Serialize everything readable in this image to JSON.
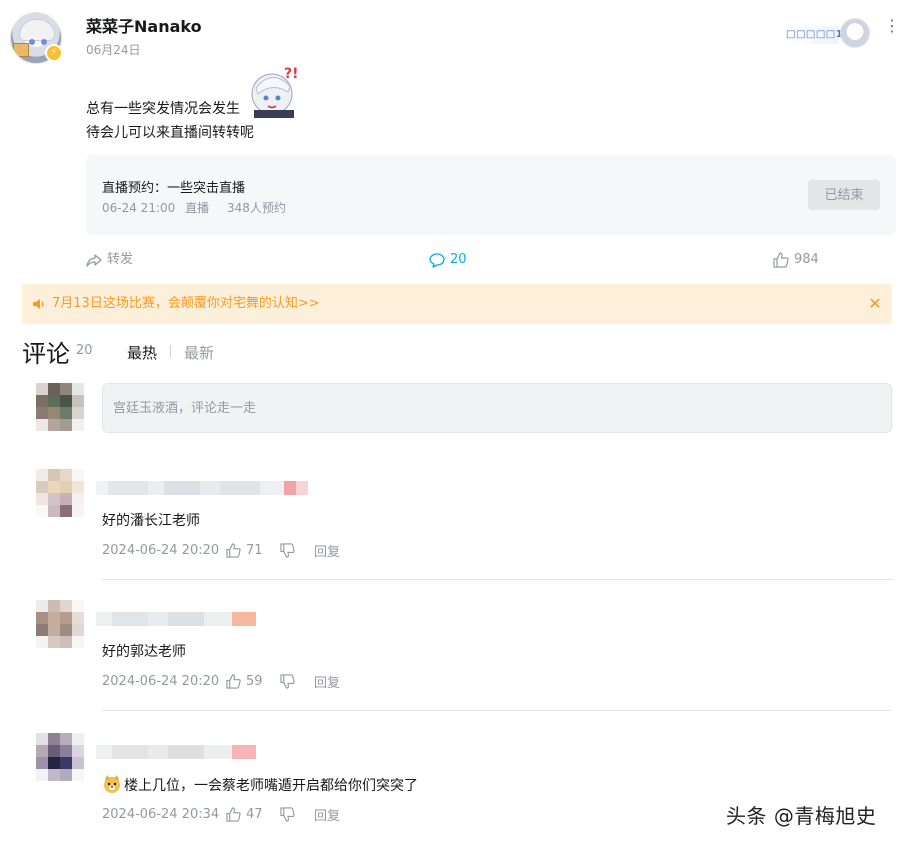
{
  "post": {
    "username": "菜菜子Nanako",
    "date": "06月24日",
    "fan_badge": "□□□□□1",
    "text_line1": "总有一些突发情况会发生",
    "text_line2": "待会儿可以来直播间转转呢",
    "live_card": {
      "title": "直播预约：一些突击直播",
      "time": "06-24 21:00",
      "type": "直播",
      "reservations": "348人预约",
      "status_button": "已结束"
    },
    "actions": {
      "forward": "转发",
      "comments": "20",
      "likes": "984"
    }
  },
  "notice": {
    "text": "7月13日这场比赛，会颠覆你对宅舞的认知>>",
    "close": "✕"
  },
  "comments_section": {
    "title": "评论",
    "count": "20",
    "sort_hot": "最热",
    "sort_new": "最新",
    "input_placeholder": "宫廷玉液酒，评论走一走"
  },
  "replies": [
    {
      "content": "好的潘长江老师",
      "time": "2024-06-24 20:20",
      "likes": "71",
      "reply_label": "回复"
    },
    {
      "content": "好的郭达老师",
      "time": "2024-06-24 20:20",
      "likes": "59",
      "reply_label": "回复"
    },
    {
      "content": "楼上几位，一会蔡老师嘴遁开启都给你们突突了",
      "time": "2024-06-24 20:34",
      "likes": "47",
      "reply_label": "回复",
      "has_emoji": true
    }
  ],
  "watermark": "头条 @青梅旭史",
  "colors": {
    "accent_blue": "#00aeec",
    "notice_bg": "#fdf0db",
    "notice_text": "#fa9a22",
    "muted_text": "#9499a0"
  }
}
